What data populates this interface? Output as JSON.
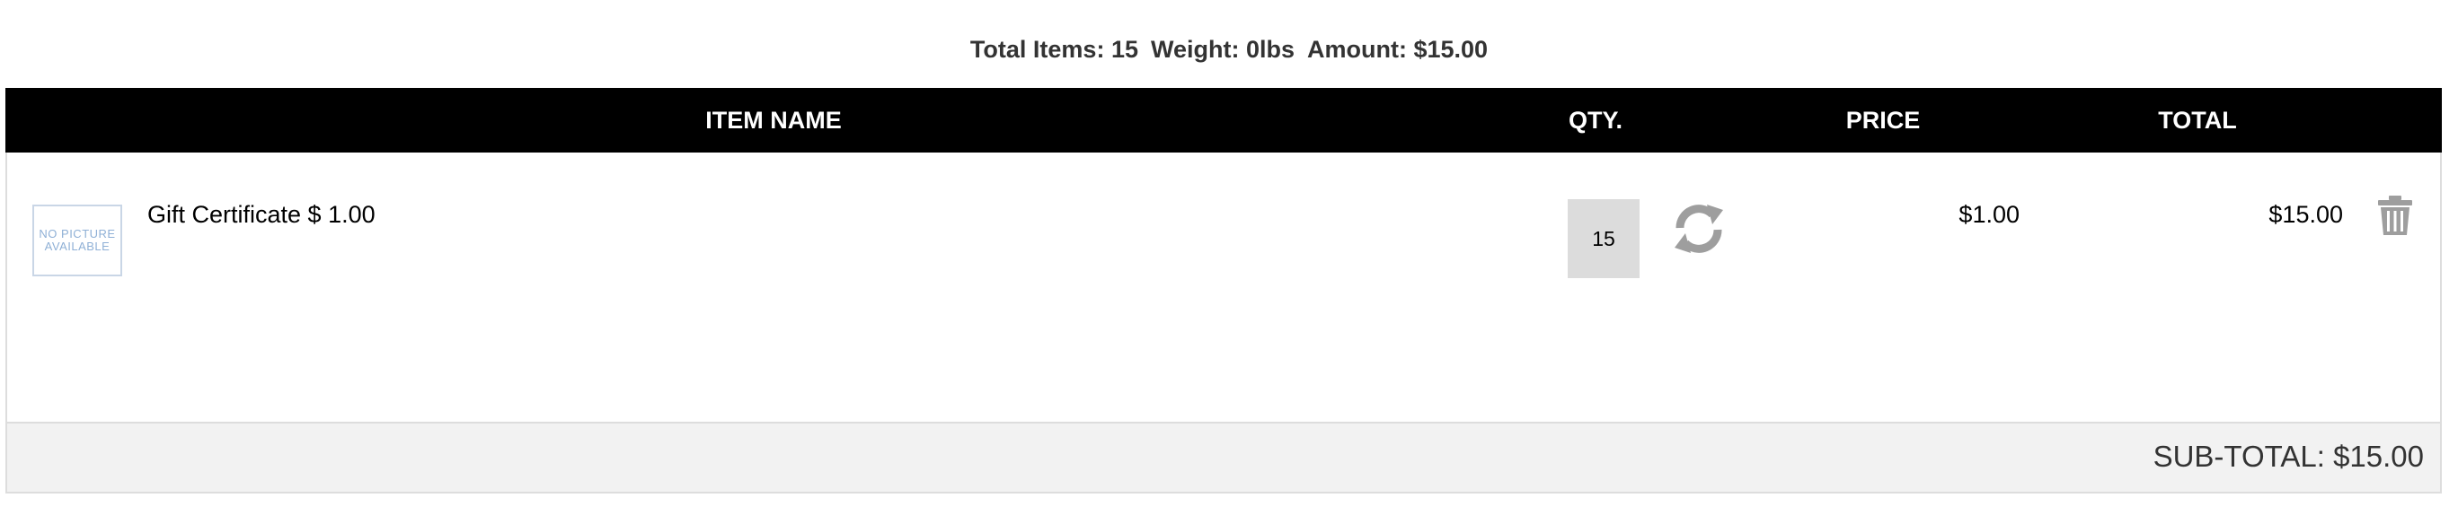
{
  "summary": {
    "total_items": "Total Items: 15",
    "weight": "Weight: 0lbs",
    "amount": "Amount: $15.00"
  },
  "table": {
    "headers": {
      "item_name": "ITEM NAME",
      "qty": "QTY.",
      "price": "PRICE",
      "total": "TOTAL"
    },
    "rows": [
      {
        "thumbnail_text": "NO PICTURE AVAILABLE",
        "name": "Gift Certificate $ 1.00",
        "qty": "15",
        "price": "$1.00",
        "total": "$15.00"
      }
    ]
  },
  "subtotal": {
    "label": "SUB-TOTAL:",
    "value": "$15.00"
  },
  "icons": {
    "update": "refresh-icon",
    "remove": "trash-icon"
  },
  "colors": {
    "header_bg": "#000000",
    "header_text": "#ffffff",
    "subtotal_bg": "#f2f2f2",
    "icon_gray": "#9e9e9e"
  }
}
